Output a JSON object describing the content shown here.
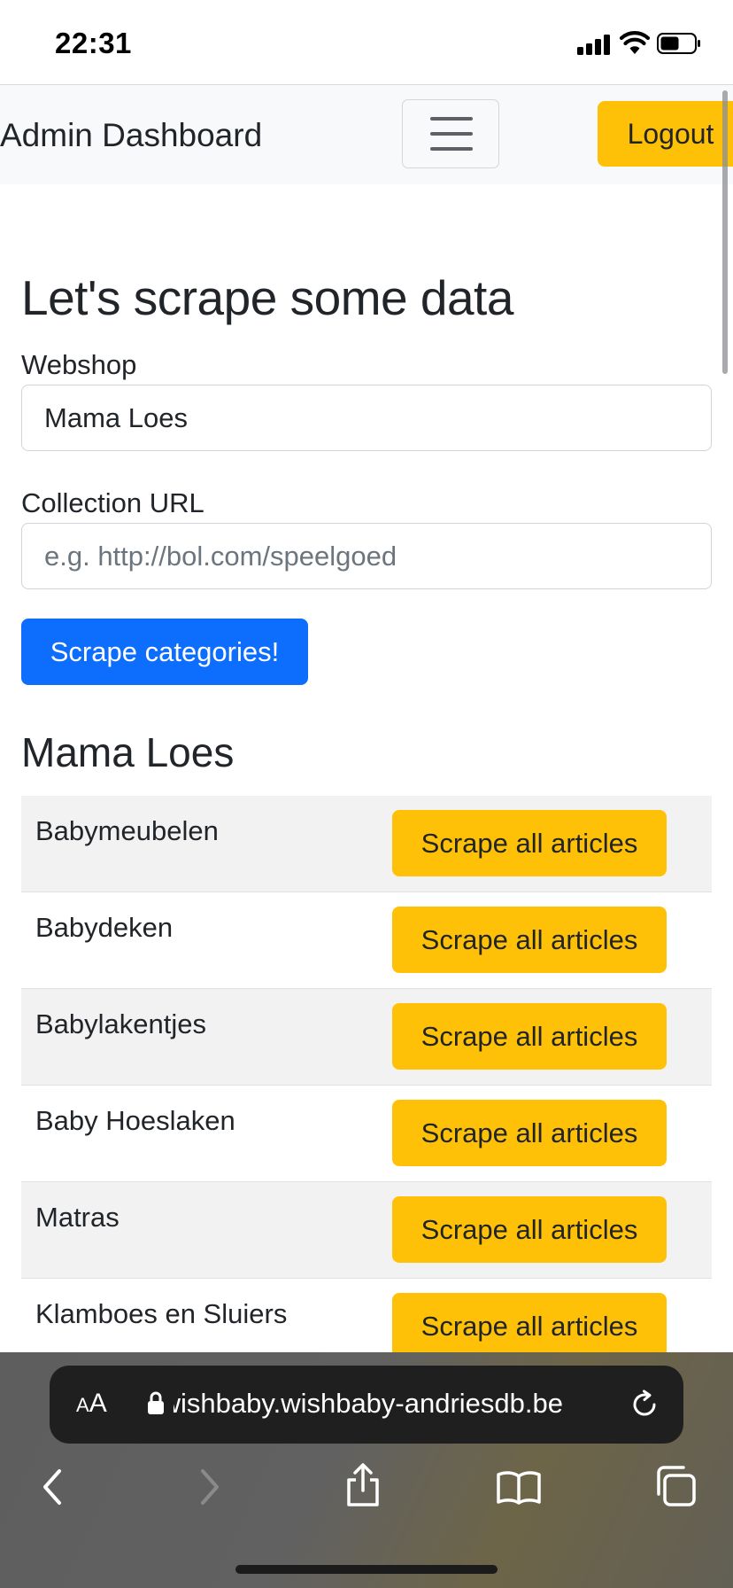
{
  "status_bar": {
    "time": "22:31"
  },
  "navbar": {
    "brand": "Admin Dashboard",
    "toggler_icon": "hamburger-menu-icon",
    "logout_label": "Logout"
  },
  "form": {
    "title": "Let's scrape some data",
    "webshop_label": "Webshop",
    "webshop_value": "Mama Loes",
    "collection_url_label": "Collection URL",
    "collection_url_placeholder": "e.g. http://bol.com/speelgoed",
    "submit_label": "Scrape categories!"
  },
  "results": {
    "title": "Mama Loes",
    "rows": [
      {
        "name": "Babymeubelen",
        "button": "Scrape all articles"
      },
      {
        "name": "Babydeken",
        "button": "Scrape all articles"
      },
      {
        "name": "Babylakentjes",
        "button": "Scrape all articles"
      },
      {
        "name": "Baby Hoeslaken",
        "button": "Scrape all articles"
      },
      {
        "name": "Matras",
        "button": "Scrape all articles"
      },
      {
        "name": "Klamboes en Sluiers",
        "button": "Scrape all articles"
      }
    ]
  },
  "browser": {
    "text_size_small": "A",
    "text_size_large": "A",
    "url": "wishbaby.wishbaby-andriesdb.be"
  },
  "colors": {
    "primary": "#0d6efd",
    "warning": "#ffc107",
    "navbar_bg": "#f8f9fa",
    "text": "#212529"
  }
}
